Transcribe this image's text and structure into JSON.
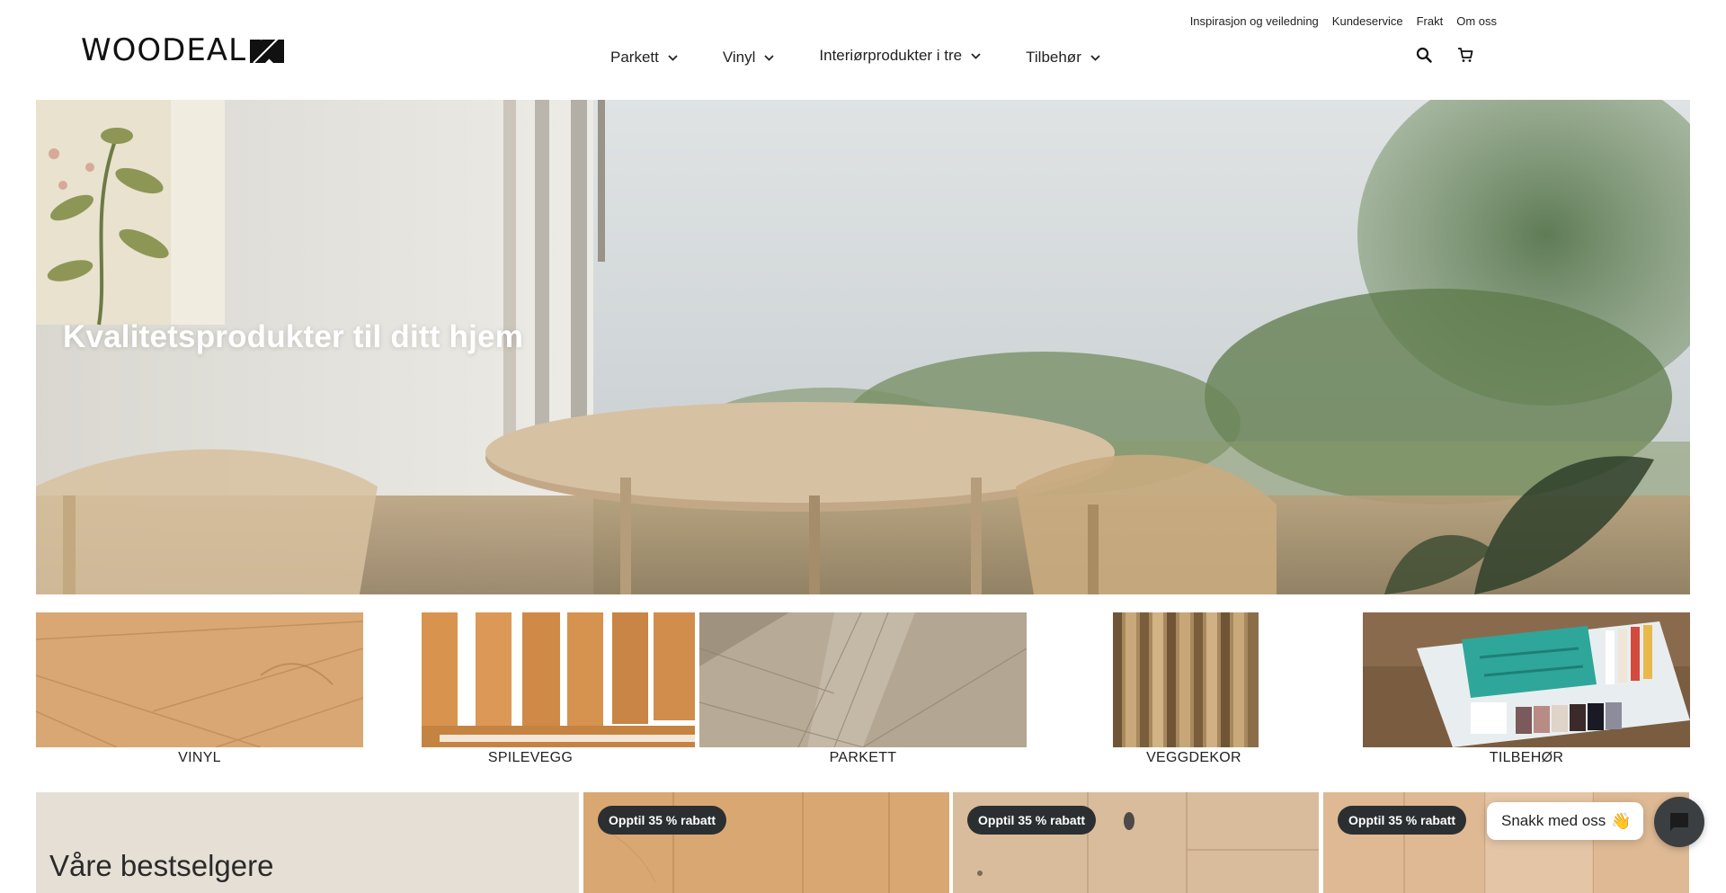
{
  "brand": {
    "logo_text": "WOODEAL",
    "logo_icon": "woodeal-logo-mark"
  },
  "utility_nav": [
    "Inspirasjon og veiledning",
    "Kundeservice",
    "Frakt",
    "Om oss"
  ],
  "main_nav": [
    {
      "label": "Parkett",
      "icon": "chevron-down-icon"
    },
    {
      "label": "Vinyl",
      "icon": "chevron-down-icon"
    },
    {
      "label": "Interiørprodukter i tre",
      "icon": "chevron-down-icon"
    },
    {
      "label": "Tilbehør",
      "icon": "chevron-down-icon"
    }
  ],
  "header_icons": [
    "search-icon",
    "cart-icon"
  ],
  "hero": {
    "title": "Kvalitetsprodukter til ditt hjem"
  },
  "categories": [
    "VINYL",
    "SPILEVEGG",
    "PARKETT",
    "VEGGDEKOR",
    "TILBEHØR"
  ],
  "bestsellers": {
    "title": "Våre bestselgere",
    "badges": [
      "Opptil 35 % rabatt",
      "Opptil 35 % rabatt",
      "Opptil 35 % rabatt"
    ]
  },
  "chat": {
    "label": "Snakk med oss",
    "emoji": "👋",
    "icon": "chat-icon"
  },
  "colors": {
    "hero_title": "#ffffff",
    "badge_bg": "#2c2f31",
    "bestseller_panel": "#e6dfd6",
    "chat_button": "#3b3f41"
  }
}
